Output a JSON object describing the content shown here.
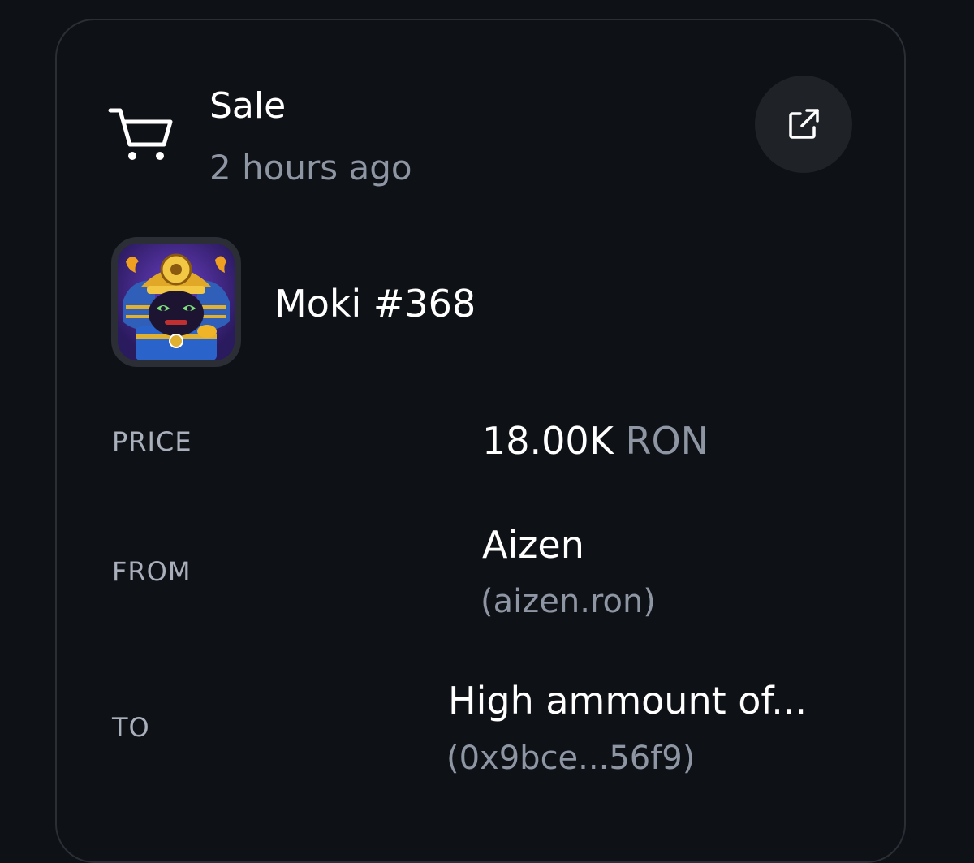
{
  "event": {
    "type_label": "Sale",
    "time_label": "2 hours ago",
    "icon": "cart-icon",
    "external_link_icon": "external-link-icon"
  },
  "nft": {
    "name": "Moki #368",
    "image": "moki-samurai-avatar"
  },
  "details": {
    "price": {
      "label": "PRICE",
      "amount": "18.00K",
      "unit": "RON"
    },
    "from": {
      "label": "FROM",
      "name": "Aizen",
      "address": "(aizen.ron)"
    },
    "to": {
      "label": "TO",
      "name": "High ammount of...",
      "address": "(0x9bce...56f9)"
    }
  },
  "colors": {
    "background": "#0e1116",
    "border": "#2a2e35",
    "muted_text": "#8f96a3",
    "label_text": "#aab0bb",
    "button_bg": "#1f2227"
  }
}
